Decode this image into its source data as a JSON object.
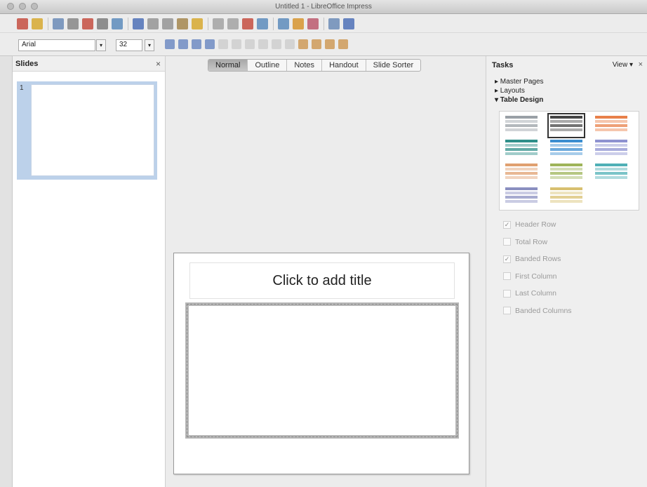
{
  "window": {
    "title": "Untitled 1 - LibreOffice Impress"
  },
  "formatting": {
    "font_name": "Arial",
    "font_size": "32"
  },
  "slides_panel": {
    "title": "Slides",
    "close_glyph": "×",
    "slide_number": "1"
  },
  "view_tabs": [
    {
      "label": "Normal",
      "active": true
    },
    {
      "label": "Outline",
      "active": false
    },
    {
      "label": "Notes",
      "active": false
    },
    {
      "label": "Handout",
      "active": false
    },
    {
      "label": "Slide Sorter",
      "active": false
    }
  ],
  "slide": {
    "title_placeholder": "Click to add title"
  },
  "tasks_panel": {
    "title": "Tasks",
    "view_label": "View",
    "close_glyph": "×",
    "sections": [
      {
        "label": "Master Pages",
        "expander": "▸"
      },
      {
        "label": "Layouts",
        "expander": "▸"
      },
      {
        "label": "Table Design",
        "expander": "▾"
      }
    ],
    "table_styles": [
      {
        "name": "gray",
        "color": "#9aa0a6",
        "selected": false
      },
      {
        "name": "black-white",
        "color": "#444444",
        "selected": true
      },
      {
        "name": "orange",
        "color": "#e8804a",
        "selected": false
      },
      {
        "name": "teal",
        "color": "#2f8f8a",
        "selected": false
      },
      {
        "name": "blue",
        "color": "#3b8ed0",
        "selected": false
      },
      {
        "name": "lavender",
        "color": "#8e92d0",
        "selected": false
      },
      {
        "name": "peach",
        "color": "#e0a070",
        "selected": false
      },
      {
        "name": "olive",
        "color": "#9eb45a",
        "selected": false
      },
      {
        "name": "cyan",
        "color": "#4fb0b6",
        "selected": false
      },
      {
        "name": "slate",
        "color": "#8a8fc0",
        "selected": false
      },
      {
        "name": "sand",
        "color": "#d8c070",
        "selected": false
      }
    ],
    "options": [
      {
        "label": "Header Row",
        "checked": true
      },
      {
        "label": "Total Row",
        "checked": false
      },
      {
        "label": "Banded Rows",
        "checked": true
      },
      {
        "label": "First Column",
        "checked": false
      },
      {
        "label": "Last Column",
        "checked": false
      },
      {
        "label": "Banded Columns",
        "checked": false
      }
    ]
  },
  "toolbar_icons": {
    "row1": [
      "new-document-icon",
      "open-folder-icon",
      "save-icon",
      "export-icon",
      "pdf-icon",
      "print-icon",
      "preview-icon",
      "spellcheck-icon",
      "cut-icon",
      "copy-icon",
      "paste-icon",
      "clone-format-icon",
      "undo-icon",
      "redo-icon",
      "chart-icon",
      "table-icon",
      "image-icon",
      "zoom-icon",
      "fontwork-icon",
      "slide-show-icon",
      "help-icon"
    ],
    "row2": [
      "font-color-icon",
      "bold-icon",
      "italic-icon",
      "underline-icon",
      "align-left-icon",
      "align-center-icon",
      "align-right-icon",
      "bullets-icon",
      "indent-icon",
      "outdent-icon",
      "line-icon",
      "area-icon",
      "shadow-icon",
      "position-icon"
    ]
  }
}
